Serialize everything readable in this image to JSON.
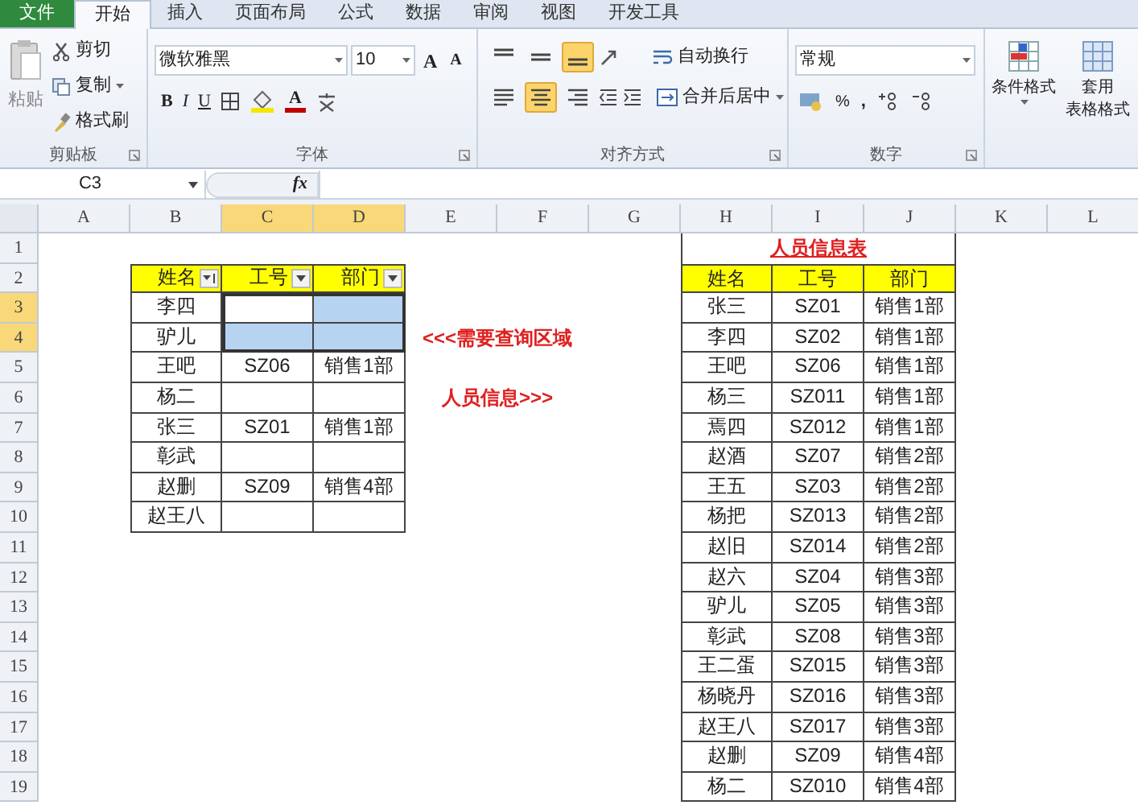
{
  "ribbon": {
    "tabs": [
      {
        "label": "文件",
        "kind": "file",
        "selected": false
      },
      {
        "label": "开始",
        "kind": "tab",
        "selected": true
      },
      {
        "label": "插入",
        "kind": "tab",
        "selected": false
      },
      {
        "label": "页面布局",
        "kind": "tab",
        "selected": false
      },
      {
        "label": "公式",
        "kind": "tab",
        "selected": false
      },
      {
        "label": "数据",
        "kind": "tab",
        "selected": false
      },
      {
        "label": "审阅",
        "kind": "tab",
        "selected": false
      },
      {
        "label": "视图",
        "kind": "tab",
        "selected": false
      },
      {
        "label": "开发工具",
        "kind": "tab",
        "selected": false
      }
    ],
    "clipboard": {
      "paste": "粘贴",
      "label": "剪贴板",
      "items": [
        {
          "label": "剪切",
          "kind": "cut",
          "dropdown": false
        },
        {
          "label": "复制",
          "kind": "copy",
          "dropdown": true
        },
        {
          "label": "格式刷",
          "kind": "brush",
          "dropdown": false
        }
      ]
    },
    "font": {
      "family": "微软雅黑",
      "size": "10",
      "grow": "A",
      "shrink": "A",
      "bold": "B",
      "italic": "I",
      "underline": "U",
      "color_letter": "A",
      "label": "字体"
    },
    "alignment": {
      "vertical": [
        {
          "kind": "top",
          "selected": false
        },
        {
          "kind": "middle",
          "selected": false
        },
        {
          "kind": "bottom",
          "selected": true
        }
      ],
      "horizontal": [
        {
          "kind": "left",
          "selected": false
        },
        {
          "kind": "center",
          "selected": true
        },
        {
          "kind": "right",
          "selected": false
        }
      ],
      "wrap": "自动换行",
      "merge": "合并后居中",
      "label": "对齐方式"
    },
    "number": {
      "format": "常规",
      "percent": "%",
      "comma": ",",
      "label": "数字"
    },
    "styles": {
      "conditional": "条件格式",
      "table_format": [
        "套用",
        "表格格式"
      ]
    }
  },
  "formula_bar": {
    "name_box": "C3",
    "fx": "fx"
  },
  "sheet": {
    "columns": [
      {
        "label": "A",
        "selected": false
      },
      {
        "label": "B",
        "selected": false
      },
      {
        "label": "C",
        "selected": true
      },
      {
        "label": "D",
        "selected": true
      },
      {
        "label": "E",
        "selected": false
      },
      {
        "label": "F",
        "selected": false
      },
      {
        "label": "G",
        "selected": false
      },
      {
        "label": "H",
        "selected": false
      },
      {
        "label": "I",
        "selected": false
      },
      {
        "label": "J",
        "selected": false
      },
      {
        "label": "K",
        "selected": false
      },
      {
        "label": "L",
        "selected": false
      }
    ],
    "rows": [
      {
        "label": "1",
        "selected": false
      },
      {
        "label": "2",
        "selected": false
      },
      {
        "label": "3",
        "selected": true
      },
      {
        "label": "4",
        "selected": true
      },
      {
        "label": "5",
        "selected": false
      },
      {
        "label": "6",
        "selected": false
      },
      {
        "label": "7",
        "selected": false
      },
      {
        "label": "8",
        "selected": false
      },
      {
        "label": "9",
        "selected": false
      },
      {
        "label": "10",
        "selected": false
      },
      {
        "label": "11",
        "selected": false
      },
      {
        "label": "12",
        "selected": false
      },
      {
        "label": "13",
        "selected": false
      },
      {
        "label": "14",
        "selected": false
      },
      {
        "label": "15",
        "selected": false
      },
      {
        "label": "16",
        "selected": false
      },
      {
        "label": "17",
        "selected": false
      },
      {
        "label": "18",
        "selected": false
      },
      {
        "label": "19",
        "selected": false
      }
    ],
    "query_table": {
      "headers": [
        {
          "label": "姓名",
          "sorted": true
        },
        {
          "label": "工号",
          "sorted": false
        },
        {
          "label": "部门",
          "sorted": false
        }
      ],
      "rows": [
        {
          "name": "李四",
          "selected": true
        },
        {
          "name": "驴儿",
          "selected": true
        },
        {
          "name": "王吧",
          "id": "SZ06",
          "dept": "销售1部",
          "selected": false
        },
        {
          "name": "杨二",
          "selected": false
        },
        {
          "name": "张三",
          "id": "SZ01",
          "dept": "销售1部",
          "selected": false
        },
        {
          "name": "彰武",
          "selected": false
        },
        {
          "name": "赵删",
          "id": "SZ09",
          "dept": "销售4部",
          "selected": false
        },
        {
          "name": "赵王八",
          "selected": false
        }
      ]
    },
    "notes": [
      "<<<需要查询区域",
      "人员信息>>>"
    ],
    "info_table": {
      "title": "人员信息表",
      "headers": [
        "姓名",
        "工号",
        "部门"
      ],
      "rows": [
        {
          "name": "张三",
          "id": "SZ01",
          "dept": "销售1部"
        },
        {
          "name": "李四",
          "id": "SZ02",
          "dept": "销售1部"
        },
        {
          "name": "王吧",
          "id": "SZ06",
          "dept": "销售1部"
        },
        {
          "name": "杨三",
          "id": "SZ011",
          "dept": "销售1部"
        },
        {
          "name": "焉四",
          "id": "SZ012",
          "dept": "销售1部"
        },
        {
          "name": "赵酒",
          "id": "SZ07",
          "dept": "销售2部"
        },
        {
          "name": "王五",
          "id": "SZ03",
          "dept": "销售2部"
        },
        {
          "name": "杨把",
          "id": "SZ013",
          "dept": "销售2部"
        },
        {
          "name": "赵旧",
          "id": "SZ014",
          "dept": "销售2部"
        },
        {
          "name": "赵六",
          "id": "SZ04",
          "dept": "销售3部"
        },
        {
          "name": "驴儿",
          "id": "SZ05",
          "dept": "销售3部"
        },
        {
          "name": "彰武",
          "id": "SZ08",
          "dept": "销售3部"
        },
        {
          "name": "王二蛋",
          "id": "SZ015",
          "dept": "销售3部"
        },
        {
          "name": "杨晓丹",
          "id": "SZ016",
          "dept": "销售3部"
        },
        {
          "name": "赵王八",
          "id": "SZ017",
          "dept": "销售3部"
        },
        {
          "name": "赵删",
          "id": "SZ09",
          "dept": "销售4部"
        },
        {
          "name": "杨二",
          "id": "SZ010",
          "dept": "销售4部"
        }
      ]
    }
  }
}
